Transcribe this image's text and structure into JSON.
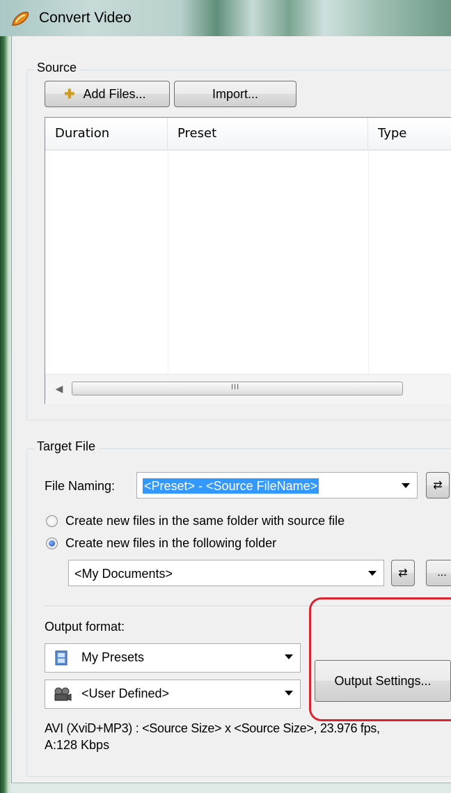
{
  "window": {
    "title": "Convert Video"
  },
  "source": {
    "group_label": "Source",
    "add_files_label": "Add Files...",
    "import_label": "Import...",
    "columns": [
      "Duration",
      "Preset",
      "Type"
    ],
    "scroll_grip": "III"
  },
  "target": {
    "group_label": "Target File",
    "file_naming_label": "File Naming:",
    "file_naming_value": "<Preset> - <Source FileName>",
    "radio_same_folder": "Create new files in the same folder with source file",
    "radio_following_folder": "Create new files in the following folder",
    "radio_selected": "following_folder",
    "folder_value": "<My Documents>",
    "browse_label": "..."
  },
  "output": {
    "format_label": "Output format:",
    "preset_group": "My Presets",
    "preset_value": "<User Defined>",
    "settings_button": "Output Settings...",
    "summary_line1": "AVI (XviD+MP3) : <Source Size> x <Source Size>, 23.976 fps,",
    "summary_line2": "A:128 Kbps"
  },
  "colors": {
    "highlight": "#d9232e",
    "selection": "#3399ff"
  },
  "icons": {
    "app": "app-logo-icon",
    "add": "plus-icon",
    "refresh": "swap-arrows-icon",
    "presets": "film-icon",
    "user_defined": "camera-icon"
  }
}
